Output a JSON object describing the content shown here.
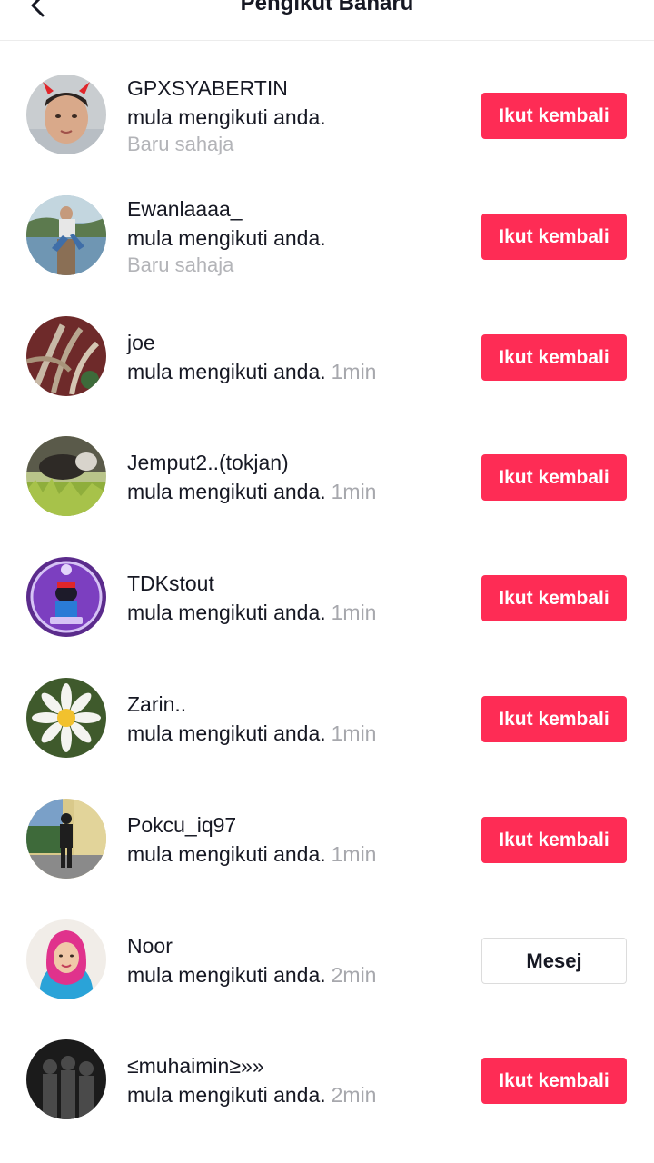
{
  "header": {
    "title": "Pengikut Baharu"
  },
  "followers": [
    {
      "name": "GPXSYABERTIN",
      "action": "mula mengikuti anda.",
      "time": "Baru sahaja",
      "time_position": "below",
      "button": "Ikut kembali",
      "button_type": "primary",
      "avatar": "boy-with-devil-horns"
    },
    {
      "name": "Ewanlaaaa_",
      "action": "mula mengikuti anda.",
      "time": "Baru sahaja",
      "time_position": "below",
      "button": "Ikut kembali",
      "button_type": "primary",
      "avatar": "person-by-lake"
    },
    {
      "name": "joe",
      "action": "mula mengikuti anda.",
      "time": "1min",
      "time_position": "inline",
      "button": "Ikut kembali",
      "button_type": "primary",
      "avatar": "dried-plants"
    },
    {
      "name": "Jemput2..(tokjan)",
      "action": "mula mengikuti anda.",
      "time": "1min",
      "time_position": "inline",
      "button": "Ikut kembali",
      "button_type": "primary",
      "avatar": "cattle-in-grass"
    },
    {
      "name": "TDKstout",
      "action": "mula mengikuti anda.",
      "time": "1min",
      "time_position": "inline",
      "button": "Ikut kembali",
      "button_type": "primary",
      "avatar": "purple-badge"
    },
    {
      "name": "Zarin..",
      "action": "mula mengikuti anda.",
      "time": "1min",
      "time_position": "inline",
      "button": "Ikut kembali",
      "button_type": "primary",
      "avatar": "daisy-flower"
    },
    {
      "name": "Pokcu_iq97",
      "action": "mula mengikuti anda.",
      "time": "1min",
      "time_position": "inline",
      "button": "Ikut kembali",
      "button_type": "primary",
      "avatar": "person-standing"
    },
    {
      "name": "Noor",
      "action": "mula mengikuti anda.",
      "time": "2min",
      "time_position": "inline",
      "button": "Mesej",
      "button_type": "secondary",
      "avatar": "woman-pink-hijab"
    },
    {
      "name": "≤muhaimin≥»»",
      "action": "mula mengikuti anda.",
      "time": "2min",
      "time_position": "inline",
      "button": "Ikut kembali",
      "button_type": "primary",
      "avatar": "silhouette-group"
    }
  ],
  "colors": {
    "accent": "#fe2c55",
    "text": "#161823",
    "muted": "#a7a8ad"
  }
}
